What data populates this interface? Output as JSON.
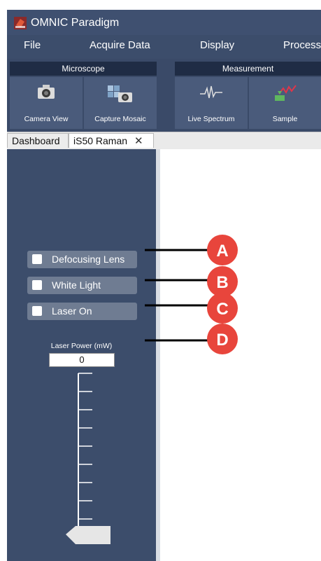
{
  "app": {
    "title": "OMNIC Paradigm"
  },
  "menu": [
    "File",
    "Acquire Data",
    "Display",
    "Process"
  ],
  "ribbon": {
    "groups": [
      {
        "title": "Microscope",
        "buttons": [
          "Camera View",
          "Capture Mosaic"
        ]
      },
      {
        "title": "Measurement",
        "buttons": [
          "Live Spectrum",
          "Sample"
        ]
      }
    ]
  },
  "tabs": [
    {
      "label": "Dashboard"
    },
    {
      "label": "iS50 Raman",
      "close": "✕"
    }
  ],
  "controls": {
    "defocusing_lens": "Defocusing Lens",
    "white_light": "White Light",
    "laser_on": "Laser On",
    "laser_power_label": "Laser Power (mW)",
    "laser_power_value": "0"
  },
  "callouts": [
    "A",
    "B",
    "C",
    "D"
  ],
  "colors": {
    "callout": "#e8453c",
    "panel": "#3c4d6b",
    "button": "#6f7c92"
  }
}
